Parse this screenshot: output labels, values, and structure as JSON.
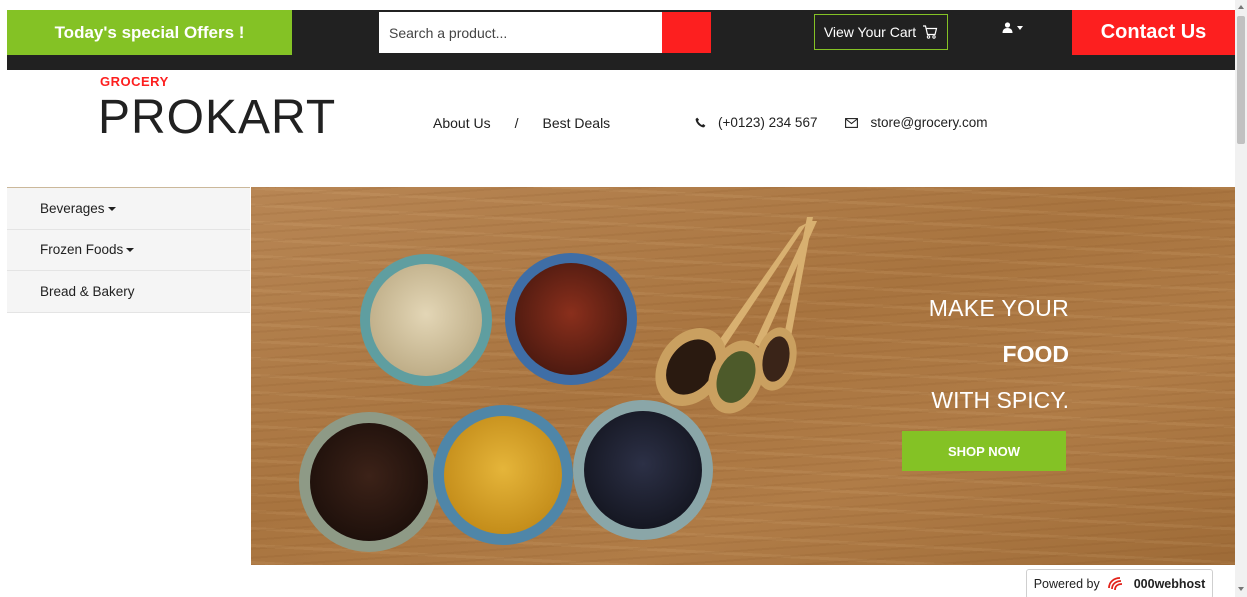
{
  "topbar": {
    "offers_label": "Today's special Offers !",
    "search_placeholder": "Search a product...",
    "cart_label": "View Your Cart",
    "contact_label": "Contact Us"
  },
  "header": {
    "logo_small": "GROCERY",
    "logo_big": "PROKART",
    "nav": [
      "About Us",
      "/",
      "Best Deals"
    ],
    "phone": "(+0123) 234 567",
    "email": "store@grocery.com"
  },
  "sidebar": {
    "items": [
      {
        "label": "Beverages",
        "has_dropdown": true
      },
      {
        "label": "Frozen Foods",
        "has_dropdown": true
      },
      {
        "label": "Bread & Bakery",
        "has_dropdown": false
      }
    ]
  },
  "banner": {
    "line1": "MAKE YOUR",
    "line2": "FOOD",
    "line3": "WITH SPICY.",
    "cta": "SHOP NOW"
  },
  "footer_badge": {
    "prefix": "Powered by",
    "brand": "000webhost"
  },
  "colors": {
    "accent_green": "#84c225",
    "accent_red": "#fd1f1f",
    "dark": "#212121"
  },
  "icons": {
    "cart": "cart-icon",
    "user": "user-icon",
    "phone": "phone-icon",
    "email": "envelope-icon",
    "search": "search-icon"
  }
}
